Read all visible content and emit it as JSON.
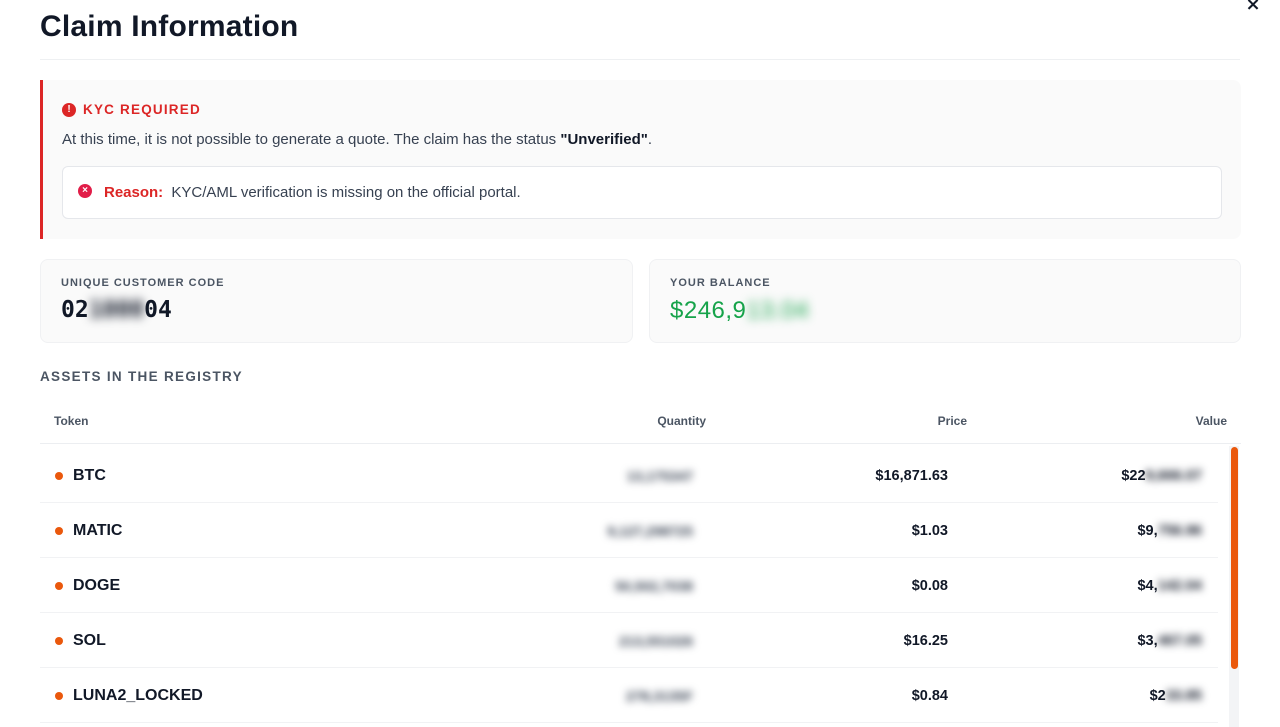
{
  "modal": {
    "title": "Claim Information",
    "close_icon": "×"
  },
  "kyc": {
    "icon": "!",
    "label": "KYC REQUIRED",
    "message_prefix": "At this time, it is not possible to generate a quote. The claim has the status",
    "status": "\"Unverified\"",
    "message_suffix": ".",
    "reason_icon": "×",
    "reason_label": "Reason:",
    "reason_text": "KYC/AML verification is missing on the official portal."
  },
  "customer": {
    "label": "UNIQUE CUSTOMER CODE",
    "code_visible_start": "02",
    "code_hidden": "1000",
    "code_visible_end": "04"
  },
  "balance": {
    "label": "YOUR BALANCE",
    "visible": "$246,9",
    "hidden": "13.04"
  },
  "assets": {
    "section_title": "ASSETS IN THE REGISTRY",
    "columns": {
      "token": "Token",
      "quantity": "Quantity",
      "price": "Price",
      "value": "Value"
    },
    "rows": [
      {
        "token": "BTC",
        "quantity": "13,175347",
        "price": "$16,871.63",
        "value_visible": "$22",
        "value_hidden": "9,666.07"
      },
      {
        "token": "MATIC",
        "quantity": "9,127,298725",
        "price": "$1.03",
        "value_visible": "$9,",
        "value_hidden": "756.96"
      },
      {
        "token": "DOGE",
        "quantity": "50,502,7038",
        "price": "$0.08",
        "value_visible": "$4,",
        "value_hidden": "142.04"
      },
      {
        "token": "SOL",
        "quantity": "213,551026",
        "price": "$16.25",
        "value_visible": "$3,",
        "value_hidden": "467.05"
      },
      {
        "token": "LUNA2_LOCKED",
        "quantity": "278,3135F",
        "price": "$0.84",
        "value_visible": "$2",
        "value_hidden": "33.85"
      }
    ]
  },
  "colors": {
    "accent_red": "#dc2626",
    "balance_green": "#16a34a",
    "orange": "#ea580c"
  }
}
